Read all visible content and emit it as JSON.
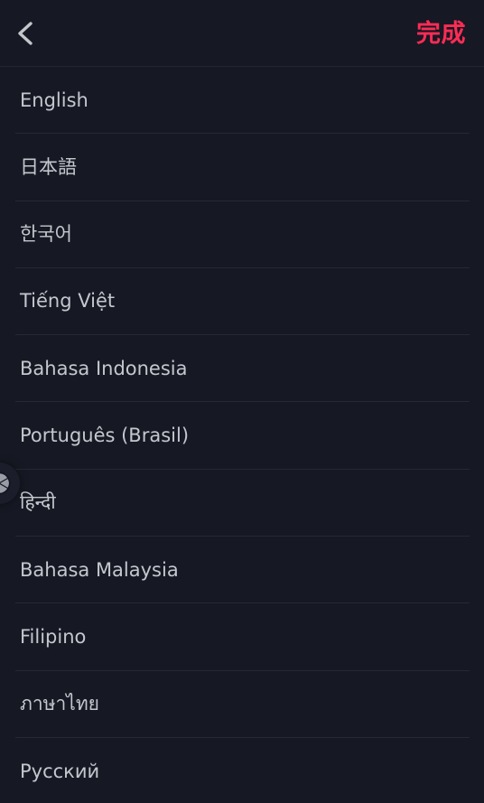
{
  "header": {
    "back_icon": "chevron-left-icon",
    "done_label": "完成",
    "done_color": "#fe2c55",
    "back_color": "#c4c6cc"
  },
  "overlay": {
    "shutter_icon": "camera-aperture-icon"
  },
  "theme": {
    "background": "#161823",
    "text": "#c5c7ce",
    "divider": "#262935",
    "header_divider": "#22242f"
  },
  "language_list": {
    "items": [
      {
        "label": "English"
      },
      {
        "label": "日本語"
      },
      {
        "label": "한국어"
      },
      {
        "label": "Tiếng Việt"
      },
      {
        "label": "Bahasa Indonesia"
      },
      {
        "label": "Português (Brasil)"
      },
      {
        "label": "हिन्दी"
      },
      {
        "label": "Bahasa Malaysia"
      },
      {
        "label": "Filipino"
      },
      {
        "label": "ภาษาไทย"
      },
      {
        "label": "Русский"
      }
    ]
  }
}
